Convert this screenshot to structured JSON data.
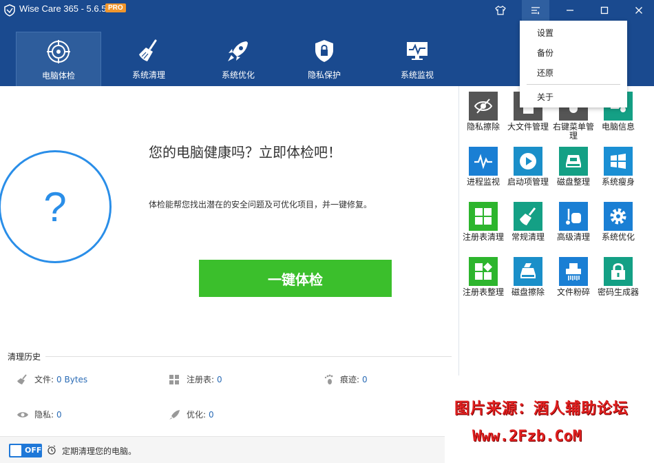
{
  "app": {
    "title": "Wise Care 365 - 5.6.5",
    "badge": "PRO"
  },
  "nav": [
    {
      "label": "电脑体检",
      "icon": "radar-target-icon",
      "active": true
    },
    {
      "label": "系统清理",
      "icon": "broom-icon"
    },
    {
      "label": "系统优化",
      "icon": "rocket-icon"
    },
    {
      "label": "隐私保护",
      "icon": "shield-lock-icon"
    },
    {
      "label": "系统监视",
      "icon": "monitor-pulse-icon"
    }
  ],
  "menu": {
    "settings": "设置",
    "backup": "备份",
    "restore": "还原",
    "about": "关于"
  },
  "main": {
    "headline": "您的电脑健康吗？立即体检吧！",
    "subline": "体检能帮您找出潜在的安全问题及可优化项目，并一键修复。",
    "scan_button": "一键体检",
    "qmark": "?"
  },
  "history": {
    "title": "清理历史",
    "files_label": "文件:",
    "files_value": "0 Bytes",
    "registry_label": "注册表:",
    "registry_value": "0",
    "traces_label": "痕迹:",
    "traces_value": "0",
    "privacy_label": "隐私:",
    "privacy_value": "0",
    "optimize_label": "优化:",
    "optimize_value": "0"
  },
  "schedule": {
    "toggle": "OFF",
    "text": "定期清理您的电脑。"
  },
  "tools": [
    {
      "label": "隐私擦除",
      "color": "#555555"
    },
    {
      "label": "大文件管理",
      "color": "#555555"
    },
    {
      "label": "右键菜单管理",
      "color": "#555555"
    },
    {
      "label": "电脑信息",
      "color": "#14a085"
    },
    {
      "label": "进程监视",
      "color": "#1a7fd4"
    },
    {
      "label": "启动项管理",
      "color": "#1a8fc9"
    },
    {
      "label": "磁盘整理",
      "color": "#14a085"
    },
    {
      "label": "系统瘦身",
      "color": "#1a8fd4"
    },
    {
      "label": "注册表清理",
      "color": "#2db52d"
    },
    {
      "label": "常规清理",
      "color": "#14a085"
    },
    {
      "label": "高级清理",
      "color": "#1a7fd4"
    },
    {
      "label": "系统优化",
      "color": "#1a7fd4"
    },
    {
      "label": "注册表整理",
      "color": "#2db52d"
    },
    {
      "label": "磁盘擦除",
      "color": "#1a8fc9"
    },
    {
      "label": "文件粉碎",
      "color": "#1a7fd4"
    },
    {
      "label": "密码生成器",
      "color": "#14a085"
    }
  ],
  "watermark": {
    "line1": "图片来源：酒人辅助论坛",
    "line2": "Www.2Fzb.CoM"
  }
}
